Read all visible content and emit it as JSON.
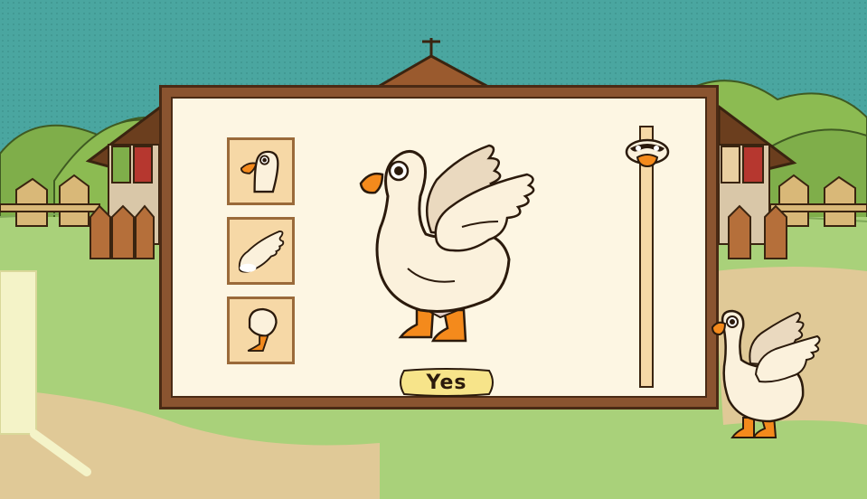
{
  "dialog": {
    "parts": [
      {
        "name": "head",
        "icon": "goose-head-icon"
      },
      {
        "name": "wing",
        "icon": "goose-wing-icon"
      },
      {
        "name": "body",
        "icon": "goose-body-icon"
      }
    ],
    "confirm_label": "Yes",
    "size_slider": {
      "handle_icon": "goose-face-icon",
      "value_fraction": 0.05
    }
  },
  "colors": {
    "sky": "#4aa6a0",
    "grass": "#a9d17a",
    "frame": "#8a5430",
    "panel": "#fdf6e3",
    "tile": "#f6d8a6",
    "goose_beak": "#f48a1c",
    "goose_body": "#fbf1dc"
  }
}
